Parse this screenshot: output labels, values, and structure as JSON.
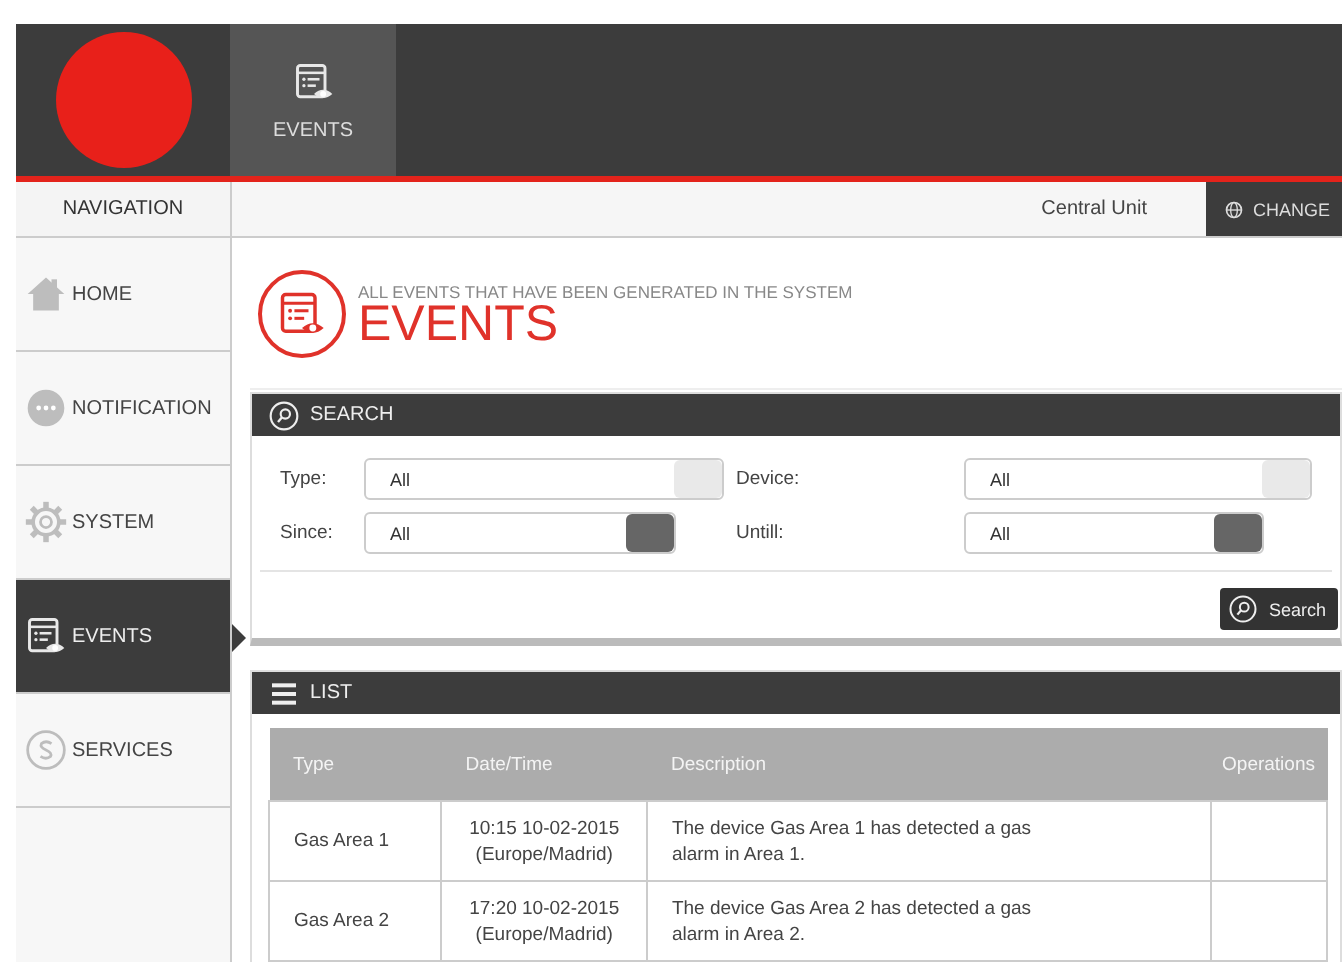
{
  "top_tabs": [
    {
      "label": "EVENTS",
      "selected": true
    }
  ],
  "navigation": {
    "title": "NAVIGATION",
    "items": [
      {
        "label": "HOME",
        "kind": "home",
        "selected": false
      },
      {
        "label": "NOTIFICATION",
        "kind": "chat",
        "selected": false
      },
      {
        "label": "SYSTEM",
        "kind": "gear",
        "selected": false
      },
      {
        "label": "EVENTS",
        "kind": "events",
        "selected": true
      },
      {
        "label": "SERVICES",
        "kind": "coin",
        "selected": false
      }
    ]
  },
  "unit_bar": {
    "unit": "Central Unit",
    "button": "CHANGE"
  },
  "page_header": {
    "subtitle": "ALL EVENTS THAT HAVE BEEN GENERATED IN THE SYSTEM",
    "title": "EVENTS"
  },
  "search": {
    "title": "SEARCH",
    "fields": [
      {
        "label": "Type:",
        "value": "All",
        "kind": "select"
      },
      {
        "label": "Device:",
        "value": "All",
        "kind": "select"
      },
      {
        "label": "Since:",
        "value": "All",
        "kind": "date"
      },
      {
        "label": "Untill:",
        "value": "All",
        "kind": "date"
      }
    ],
    "button": "Search"
  },
  "list": {
    "title": "LIST",
    "columns": [
      "Type",
      "Date/Time",
      "Description",
      "Operations"
    ],
    "rows": [
      {
        "type": "Gas Area 1",
        "datetime": "10:15 10-02-2015 (Europe/Madrid)",
        "description": "The device Gas Area 1 has detected a gas alarm in Area 1."
      },
      {
        "type": "Gas Area 2",
        "datetime": "17:20 10-02-2015 (Europe/Madrid)",
        "description": "The device Gas Area 2 has detected a gas alarm in Area 2."
      }
    ]
  }
}
